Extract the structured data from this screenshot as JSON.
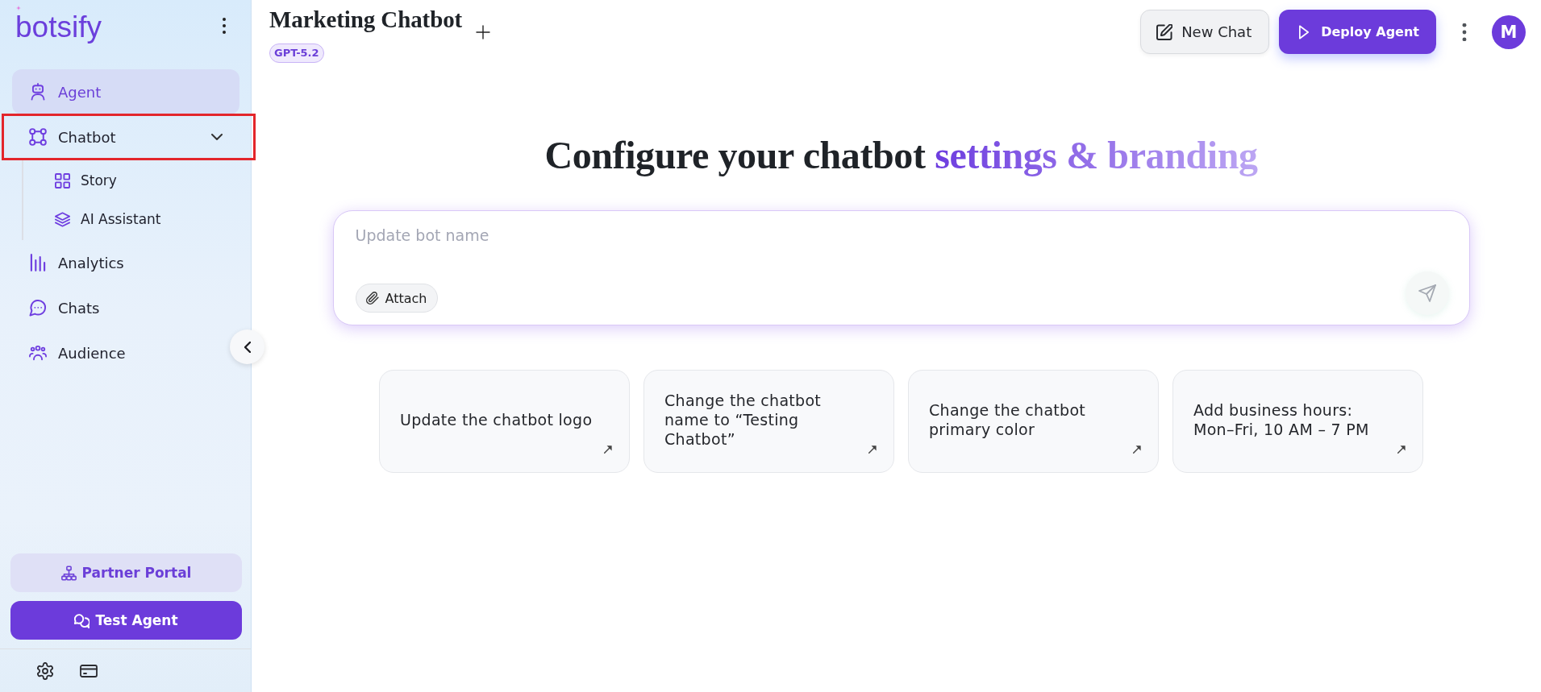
{
  "sidebar": {
    "logo": "botsify",
    "items": [
      {
        "label": "Agent",
        "selected": true,
        "highlighted": false
      },
      {
        "label": "Chatbot",
        "selected": false,
        "highlighted": true,
        "expanded": true,
        "children": [
          {
            "label": "Story",
            "selected": false
          },
          {
            "label": "AI Assistant",
            "selected": false
          }
        ]
      },
      {
        "label": "Analytics",
        "selected": false,
        "highlighted": false
      },
      {
        "label": "Chats",
        "selected": false,
        "highlighted": false
      },
      {
        "label": "Audience",
        "selected": false,
        "highlighted": false
      }
    ],
    "partner_button": "Partner Portal",
    "test_button": "Test Agent"
  },
  "header": {
    "title": "Marketing Chatbot",
    "model_badge": "GPT-5.2",
    "buttons": [
      {
        "label": "New Chat",
        "kind": "secondary"
      },
      {
        "label": "Deploy Agent",
        "kind": "primary"
      }
    ],
    "avatar": "M"
  },
  "composer": {
    "heading": "Configure your chatbot",
    "heading_accent": "settings & branding",
    "placeholder": "Update bot name",
    "attach_button": "Attach"
  },
  "suggestions": [
    {
      "text": "Update the chatbot logo"
    },
    {
      "text": "Change the chatbot name to “Testing Chatbot”"
    },
    {
      "text": "Change the chatbot primary color"
    },
    {
      "text": "Add business hours: Mon–Fri, 10 AM – 7 PM"
    }
  ]
}
